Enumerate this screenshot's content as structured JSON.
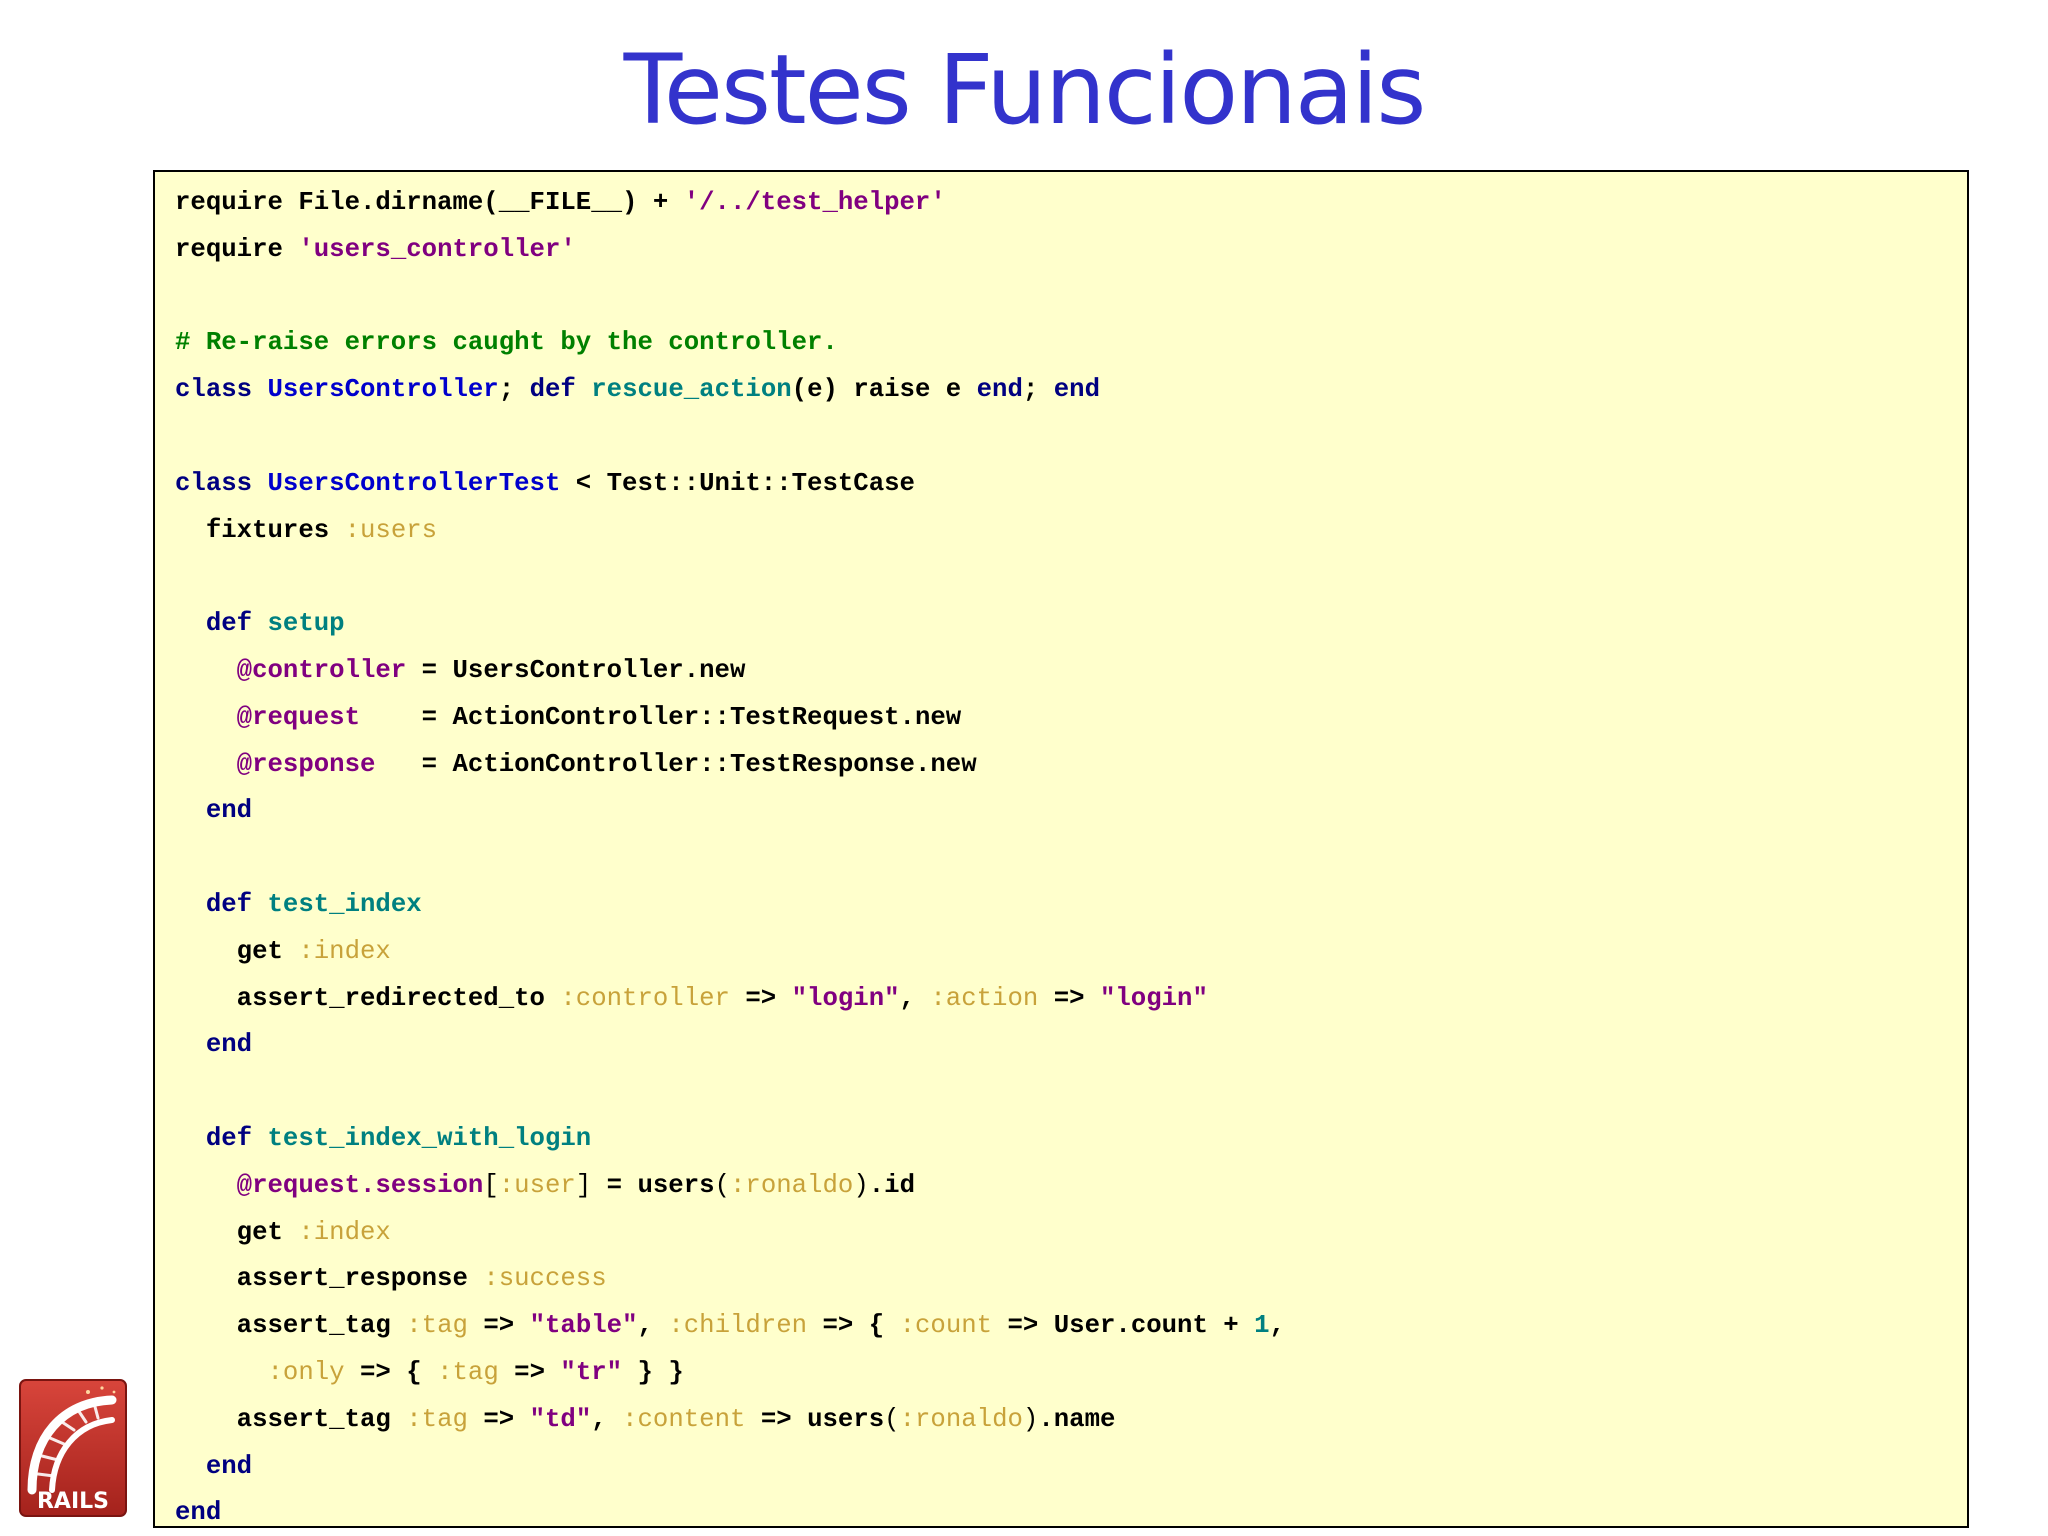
{
  "slide": {
    "title": "Testes Funcionais"
  },
  "logo": {
    "text": "RAILS",
    "icon": "rails-logo",
    "colors": {
      "red": "#c4302b",
      "dark_red": "#8b1a16",
      "white": "#ffffff"
    }
  },
  "colors": {
    "title": "#3333cc",
    "code_background": "#ffffcc",
    "keyword": "#000080",
    "constant": "#0000cc",
    "method": "#008080",
    "string": "#800080",
    "comment": "#008000",
    "symbol": "#c8a23a",
    "ivar": "#800080"
  },
  "code": {
    "language": "ruby",
    "lines": [
      [
        [
          "plain",
          "require File.dirname(__FILE__) + "
        ],
        [
          "string",
          "'/../test_helper'"
        ]
      ],
      [
        [
          "plain",
          "require "
        ],
        [
          "string",
          "'users_controller'"
        ]
      ],
      [],
      [
        [
          "comment",
          "# Re-raise errors caught by the controller."
        ]
      ],
      [
        [
          "keyword",
          "class "
        ],
        [
          "constant",
          "UsersController"
        ],
        [
          "plain",
          "; "
        ],
        [
          "keyword",
          "def "
        ],
        [
          "method",
          "rescue_action"
        ],
        [
          "plain",
          "(e) raise e "
        ],
        [
          "keyword",
          "end"
        ],
        [
          "plain",
          "; "
        ],
        [
          "keyword",
          "end"
        ]
      ],
      [],
      [
        [
          "keyword",
          "class "
        ],
        [
          "constant",
          "UsersControllerTest"
        ],
        [
          "plain",
          " < Test::Unit::TestCase"
        ]
      ],
      [
        [
          "plain",
          "  fixtures "
        ],
        [
          "symbol",
          ":users"
        ]
      ],
      [],
      [
        [
          "keyword",
          "  def "
        ],
        [
          "method",
          "setup"
        ]
      ],
      [
        [
          "plain",
          "    "
        ],
        [
          "ivar",
          "@controller"
        ],
        [
          "plain",
          " = UsersController.new"
        ]
      ],
      [
        [
          "plain",
          "    "
        ],
        [
          "ivar",
          "@request"
        ],
        [
          "plain",
          "    = ActionController::TestRequest.new"
        ]
      ],
      [
        [
          "plain",
          "    "
        ],
        [
          "ivar",
          "@response"
        ],
        [
          "plain",
          "   = ActionController::TestResponse.new"
        ]
      ],
      [
        [
          "keyword",
          "  end"
        ]
      ],
      [],
      [
        [
          "keyword",
          "  def "
        ],
        [
          "method",
          "test_index"
        ]
      ],
      [
        [
          "plain",
          "    get "
        ],
        [
          "symbol",
          ":index"
        ]
      ],
      [
        [
          "plain",
          "    assert_redirected_to "
        ],
        [
          "symbol",
          ":controller"
        ],
        [
          "plain",
          " => "
        ],
        [
          "string",
          "\"login\""
        ],
        [
          "plain",
          ", "
        ],
        [
          "symbol",
          ":action"
        ],
        [
          "plain",
          " => "
        ],
        [
          "string",
          "\"login\""
        ]
      ],
      [
        [
          "keyword",
          "  end"
        ]
      ],
      [],
      [
        [
          "keyword",
          "  def "
        ],
        [
          "method",
          "test_index_with_login"
        ]
      ],
      [
        [
          "plain",
          "    "
        ],
        [
          "ivar",
          "@request.session"
        ],
        [
          "bracket",
          "["
        ],
        [
          "symbol",
          ":user"
        ],
        [
          "bracket",
          "]"
        ],
        [
          "plain",
          " = users"
        ],
        [
          "bracket",
          "("
        ],
        [
          "symbol",
          ":ronaldo"
        ],
        [
          "bracket",
          ")"
        ],
        [
          "plain",
          ".id"
        ]
      ],
      [
        [
          "plain",
          "    get "
        ],
        [
          "symbol",
          ":index"
        ]
      ],
      [
        [
          "plain",
          "    assert_response "
        ],
        [
          "symbol",
          ":success"
        ]
      ],
      [
        [
          "plain",
          "    assert_tag "
        ],
        [
          "symbol",
          ":tag"
        ],
        [
          "plain",
          " => "
        ],
        [
          "string",
          "\"table\""
        ],
        [
          "plain",
          ", "
        ],
        [
          "symbol",
          ":children"
        ],
        [
          "plain",
          " => { "
        ],
        [
          "symbol",
          ":count"
        ],
        [
          "plain",
          " => User.count + "
        ],
        [
          "number",
          "1"
        ],
        [
          "plain",
          ","
        ]
      ],
      [
        [
          "plain",
          "      "
        ],
        [
          "symbol",
          ":only"
        ],
        [
          "plain",
          " => { "
        ],
        [
          "symbol",
          ":tag"
        ],
        [
          "plain",
          " => "
        ],
        [
          "string",
          "\"tr\""
        ],
        [
          "plain",
          " } }"
        ]
      ],
      [
        [
          "plain",
          "    assert_tag "
        ],
        [
          "symbol",
          ":tag"
        ],
        [
          "plain",
          " => "
        ],
        [
          "string",
          "\"td\""
        ],
        [
          "plain",
          ", "
        ],
        [
          "symbol",
          ":content"
        ],
        [
          "plain",
          " => users"
        ],
        [
          "bracket",
          "("
        ],
        [
          "symbol",
          ":ronaldo"
        ],
        [
          "bracket",
          ")"
        ],
        [
          "plain",
          ".name"
        ]
      ],
      [
        [
          "keyword",
          "  end"
        ]
      ],
      [
        [
          "keyword",
          "end"
        ]
      ]
    ]
  }
}
